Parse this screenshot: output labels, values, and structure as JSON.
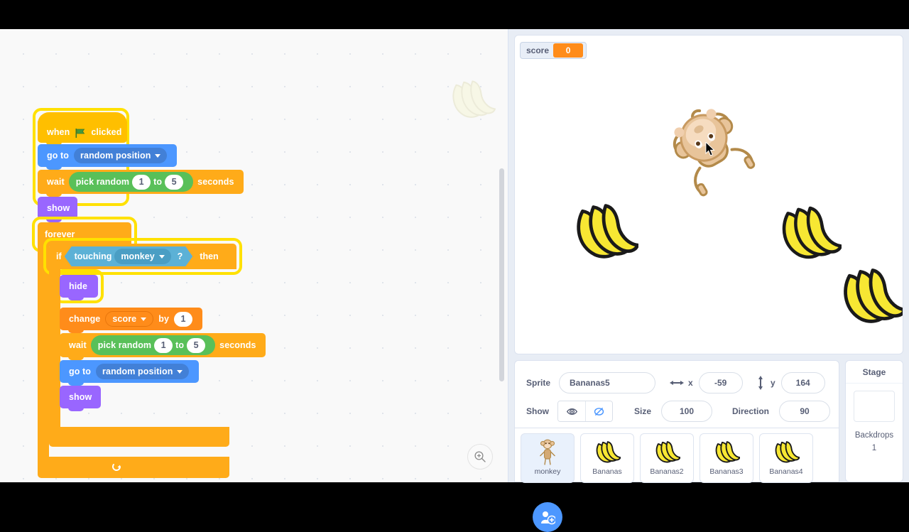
{
  "app": {
    "code_area": {
      "zoom_in_icon": "zoom-in-icon"
    }
  },
  "script": {
    "blocks": [
      {
        "id": "when_flag",
        "type": "hat",
        "category": "events",
        "text_before": "when",
        "icon": "green-flag-icon",
        "text_after": "clicked"
      },
      {
        "id": "go_to_1",
        "type": "stack",
        "category": "motion",
        "label": "go to",
        "dropdown": "random position"
      },
      {
        "id": "wait_1",
        "type": "stack",
        "category": "control",
        "label": "wait",
        "operator": "pick random",
        "from": "1",
        "mid": "to",
        "to": "5",
        "suffix": "seconds"
      },
      {
        "id": "show_1",
        "type": "stack",
        "category": "looks",
        "label": "show"
      },
      {
        "id": "forever",
        "type": "c-block",
        "category": "control",
        "label": "forever"
      },
      {
        "id": "if_then",
        "type": "c-block",
        "category": "control",
        "label_if": "if",
        "condition": "touching",
        "condition_target": "monkey",
        "question": "?",
        "label_then": "then"
      },
      {
        "id": "hide_1",
        "type": "stack",
        "category": "looks",
        "label": "hide"
      },
      {
        "id": "change_score",
        "type": "stack",
        "category": "data",
        "label": "change",
        "variable": "score",
        "by_label": "by",
        "value": "1"
      },
      {
        "id": "wait_2",
        "type": "stack",
        "category": "control",
        "label": "wait",
        "operator": "pick random",
        "from": "1",
        "mid": "to",
        "to": "5",
        "suffix": "seconds"
      },
      {
        "id": "go_to_2",
        "type": "stack",
        "category": "motion",
        "label": "go to",
        "dropdown": "random position"
      },
      {
        "id": "show_2",
        "type": "stack",
        "category": "looks",
        "label": "show"
      }
    ]
  },
  "stage": {
    "monitor": {
      "name": "score",
      "value": "0"
    },
    "sprites_on_stage": [
      {
        "name": "monkey-sprite",
        "kind": "monkey"
      },
      {
        "name": "banana-sprite-left",
        "kind": "bananas"
      },
      {
        "name": "banana-sprite-right",
        "kind": "bananas"
      },
      {
        "name": "banana-sprite-corner",
        "kind": "bananas"
      }
    ],
    "cursor": "mouse-cursor"
  },
  "sprite_info": {
    "sprite_label": "Sprite",
    "sprite_name": "Bananas5",
    "x_label": "x",
    "x_value": "-59",
    "y_label": "y",
    "y_value": "164",
    "show_label": "Show",
    "show_visible_icon": "eye-icon",
    "show_hidden_icon": "eye-crossed-icon",
    "size_label": "Size",
    "size_value": "100",
    "direction_label": "Direction",
    "direction_value": "90"
  },
  "sprite_list": {
    "items": [
      {
        "name": "monkey",
        "kind": "monkey",
        "selected": false
      },
      {
        "name": "Bananas",
        "kind": "bananas",
        "selected": false
      },
      {
        "name": "Bananas2",
        "kind": "bananas",
        "selected": false
      },
      {
        "name": "Bananas3",
        "kind": "bananas",
        "selected": false
      },
      {
        "name": "Bananas4",
        "kind": "bananas",
        "selected": false
      }
    ],
    "add_button_icon": "add-sprite-icon"
  },
  "stage_selector": {
    "title": "Stage",
    "backdrops_label": "Backdrops",
    "backdrops_count": "1"
  },
  "colors": {
    "events": "#ffbf00",
    "motion": "#4c97ff",
    "control": "#ffab19",
    "looks": "#9966ff",
    "sensing": "#5cb1d6",
    "operator": "#59c059",
    "data": "#ff8c1a",
    "glow": "#ffe100",
    "accent": "#4c97ff"
  }
}
